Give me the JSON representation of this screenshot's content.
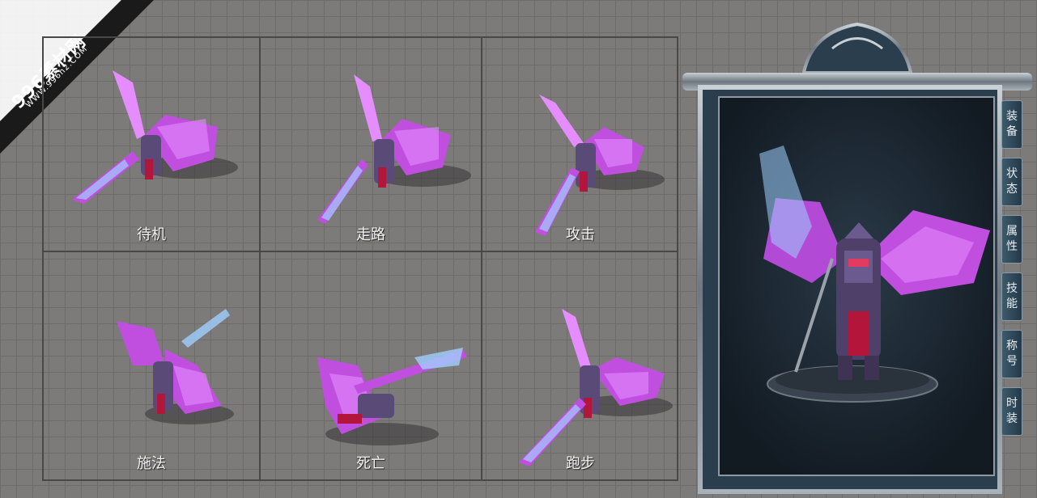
{
  "watermark": {
    "main": "996素材网",
    "sub": "WWW.996n2.COM"
  },
  "animations": [
    {
      "label": "待机"
    },
    {
      "label": "走路"
    },
    {
      "label": "攻击"
    },
    {
      "label": "施法"
    },
    {
      "label": "死亡"
    },
    {
      "label": "跑步"
    }
  ],
  "side_tabs": [
    {
      "char1": "装",
      "char2": "备"
    },
    {
      "char1": "状",
      "char2": "态"
    },
    {
      "char1": "属",
      "char2": "性"
    },
    {
      "char1": "技",
      "char2": "能"
    },
    {
      "char1": "称",
      "char2": "号"
    },
    {
      "char1": "时",
      "char2": "装"
    }
  ],
  "colors": {
    "wing": "#c04fe0",
    "wing_light": "#e58cff",
    "armor": "#5a4a78",
    "cape": "#b3163a",
    "frame": "#9aa3ab",
    "panel_bg": "#1b2733"
  }
}
